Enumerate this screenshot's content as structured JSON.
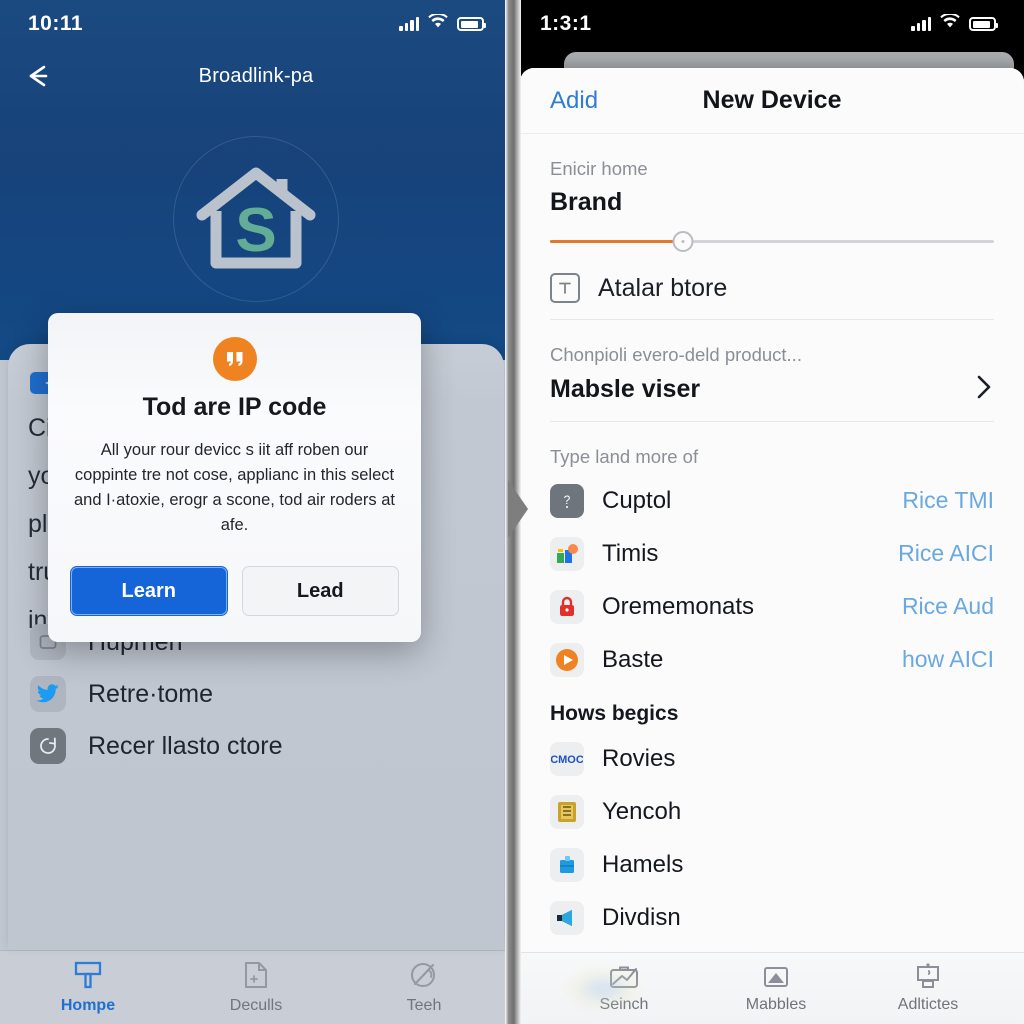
{
  "left": {
    "status": {
      "time": "10:11",
      "signal_icon": "signal-bars-icon",
      "wifi_icon": "wifi-icon",
      "battery_icon": "battery-icon"
    },
    "nav": {
      "back_icon": "back-arrow-icon",
      "title": "Broadlink-pa"
    },
    "logo": {
      "icon": "home-logo-icon",
      "letter": "S"
    },
    "card": {
      "badge_icon": "sparkle-badge-icon",
      "blurb_lines": [
        "Ci",
        "yo                                        doses",
        "plu                                        ting",
        "tru                                        t",
        "int"
      ],
      "items": [
        {
          "icon": "partial-card-icon",
          "label": "Hupmen"
        },
        {
          "icon": "twitter-bird-icon",
          "label": "Retre·tome"
        },
        {
          "icon": "restore-icon",
          "label": "Recer llasto ctore"
        }
      ]
    },
    "tabs": [
      {
        "icon": "home-tab-icon",
        "label": "Hompe",
        "active": true
      },
      {
        "icon": "documents-tab-icon",
        "label": "Deculls",
        "active": false
      },
      {
        "icon": "tech-tab-icon",
        "label": "Teeh",
        "active": false
      }
    ]
  },
  "modal": {
    "icon": "quote-marks-icon",
    "title": "Tod are IP code",
    "body": "All your rour devicc s iit aff roben our coppinte tre not cose, applianc in this select and I·atoxie, erogr a scone, tod air roders at afe.",
    "primary_button": "Learn",
    "secondary_button": "Lead",
    "primary_color": "#1565d8",
    "icon_color": "#f08321"
  },
  "divider": {
    "arrow_icon": "chevron-right-divider-icon"
  },
  "right": {
    "status": {
      "time": "1:3:1",
      "signal_icon": "signal-bars-icon",
      "wifi_icon": "wifi-icon",
      "battery_icon": "battery-icon"
    },
    "nav": {
      "left_action": "Adid",
      "title": "New Device"
    },
    "brand": {
      "caption": "Enicir home",
      "value": "Brand",
      "slider_percent": 30,
      "slider_fill_color": "#e5762a"
    },
    "store_row": {
      "icon": "label-box-icon",
      "label": "Atalar btore"
    },
    "product": {
      "caption": "Chonpioli evero-deld product...",
      "value": "Mabsle viser",
      "chevron_icon": "chevron-right-icon"
    },
    "type_section": {
      "heading": "Type land more of",
      "items": [
        {
          "icon": "question-badge-icon",
          "label": "Cuptol",
          "action": "Rice TMI"
        },
        {
          "icon": "apps-grid-icon",
          "label": "Timis",
          "action": "Rice AICI"
        },
        {
          "icon": "red-lock-icon",
          "label": "Orememonats",
          "action": "Rice Aud"
        },
        {
          "icon": "orange-play-icon",
          "label": "Baste",
          "action": "how AICI"
        }
      ]
    },
    "hows_section": {
      "heading": "Hows begics",
      "items": [
        {
          "icon": "cmoc-text-icon",
          "label": "Rovies",
          "action": ""
        },
        {
          "icon": "gold-chip-icon",
          "label": "Yencoh",
          "action": ""
        },
        {
          "icon": "blue-box-icon",
          "label": "Hamels",
          "action": ""
        },
        {
          "icon": "megaphone-icon",
          "label": "Divdisn",
          "action": ""
        }
      ]
    },
    "tabs": [
      {
        "icon": "search-briefcase-icon",
        "label": "Seinch"
      },
      {
        "icon": "mountain-icon",
        "label": "Mabbles"
      },
      {
        "icon": "monitor-icon",
        "label": "Adltictes"
      }
    ]
  }
}
